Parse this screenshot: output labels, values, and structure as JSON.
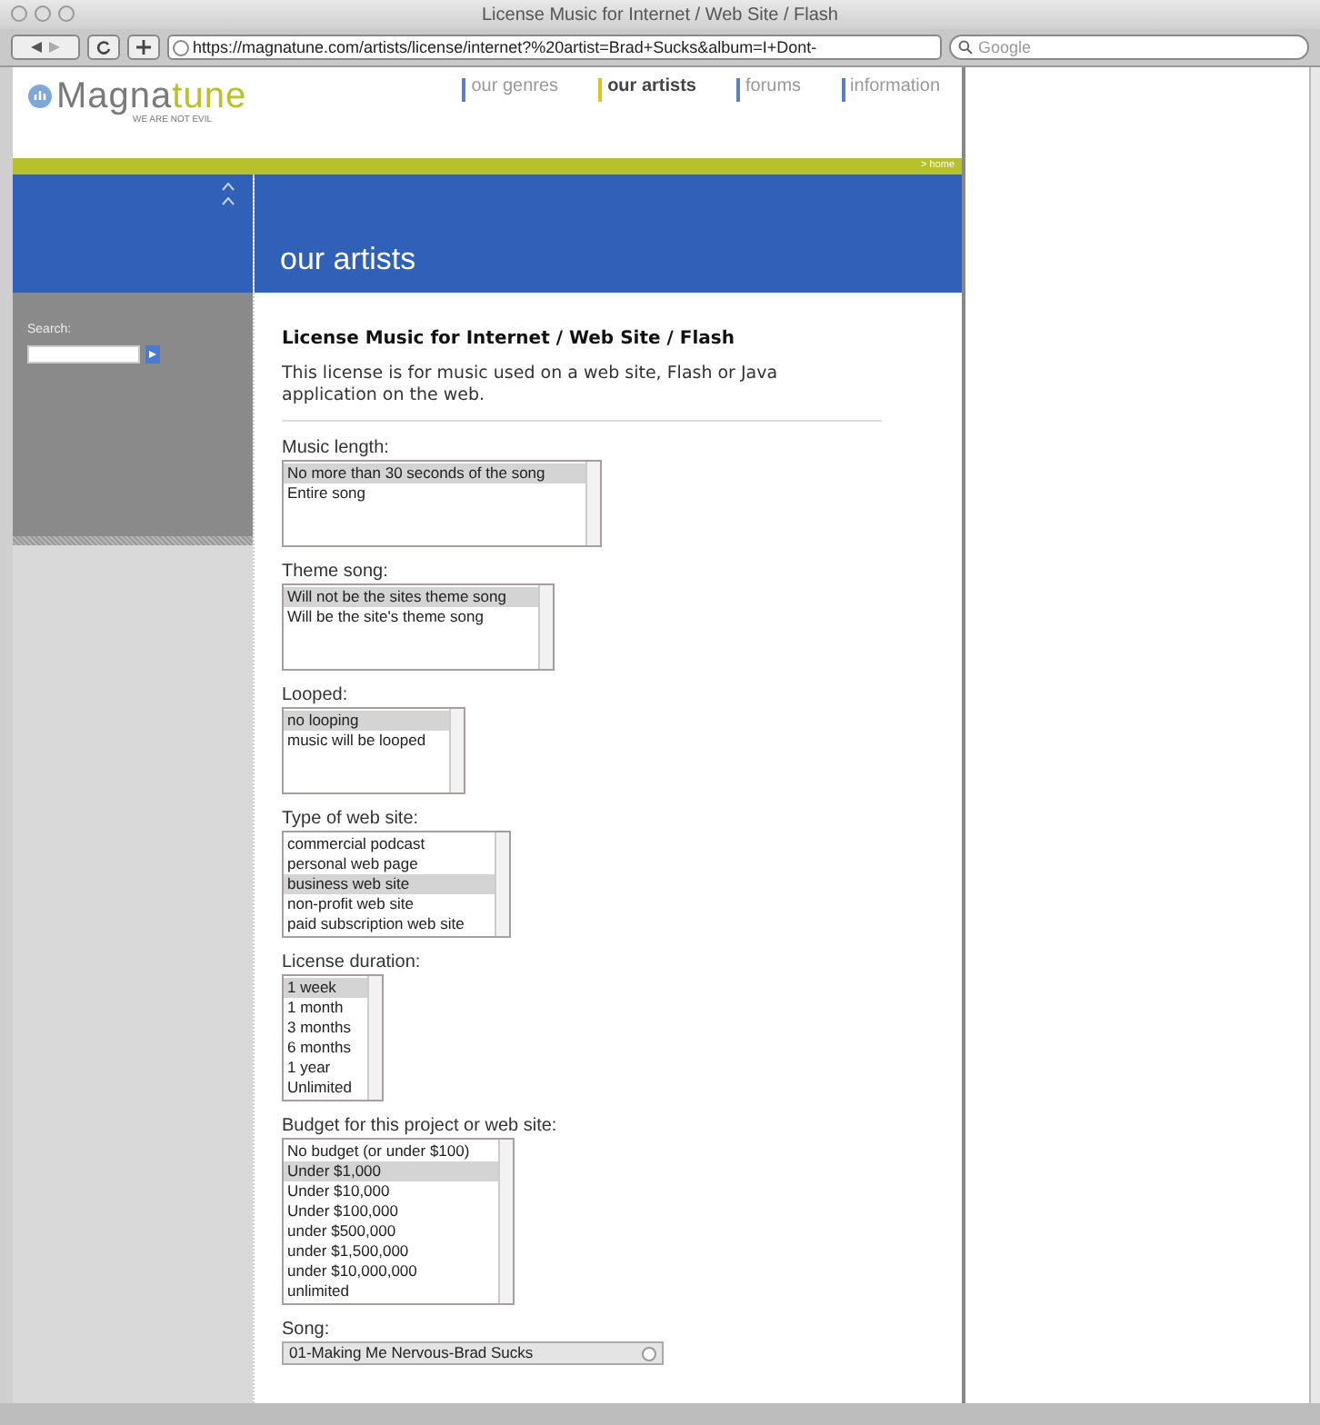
{
  "window": {
    "title": "License Music for Internet / Web Site / Flash"
  },
  "toolbar": {
    "url": "https://magnatune.com/artists/license/internet?%20artist=Brad+Sucks&album=I+Dont-",
    "search": {
      "placeholder": "Google"
    }
  },
  "site": {
    "logo": {
      "part_1": "Magna",
      "part_2": "tune",
      "tagline": "WE ARE NOT EVIL"
    },
    "nav": [
      {
        "label": "our genres",
        "selected": false,
        "color": "#5b7fc4"
      },
      {
        "label": "our artists",
        "selected": true,
        "color": "#e0c21a"
      },
      {
        "label": "forums",
        "selected": false,
        "color": "#5b7fc4"
      },
      {
        "label": "information",
        "selected": false,
        "color": "#5b7fc4"
      }
    ],
    "breadcrumb": "> home",
    "section_title": "our artists",
    "search_label": "Search:"
  },
  "form": {
    "heading": "License Music for Internet / Web Site / Flash",
    "intro": "This license is for music used on a web site, Flash or Java application on the web.",
    "fields": [
      {
        "kind": "listbox",
        "label": "Music length:",
        "options": [
          {
            "label": "No more than 30 seconds of the song",
            "selected": true
          },
          {
            "label": "Entire song",
            "selected": false
          }
        ]
      },
      {
        "kind": "listbox",
        "label": "Theme song:",
        "options": [
          {
            "label": "Will not be the sites theme song",
            "selected": true
          },
          {
            "label": "Will be the site's theme song",
            "selected": false
          }
        ]
      },
      {
        "kind": "listbox",
        "label": "Looped:",
        "options": [
          {
            "label": "no looping",
            "selected": true
          },
          {
            "label": "music will be looped",
            "selected": false
          }
        ]
      },
      {
        "kind": "listbox",
        "label": "Type of web site:",
        "options": [
          {
            "label": "commercial podcast",
            "selected": false
          },
          {
            "label": "personal web page",
            "selected": false
          },
          {
            "label": "business web site",
            "selected": true
          },
          {
            "label": "non-profit web site",
            "selected": false
          },
          {
            "label": "paid subscription web site",
            "selected": false
          }
        ]
      },
      {
        "kind": "listbox",
        "label": "License duration:",
        "options": [
          {
            "label": "1 week",
            "selected": true
          },
          {
            "label": "1 month",
            "selected": false
          },
          {
            "label": "3 months",
            "selected": false
          },
          {
            "label": "6 months",
            "selected": false
          },
          {
            "label": "1 year",
            "selected": false
          },
          {
            "label": "Unlimited",
            "selected": false
          }
        ]
      },
      {
        "kind": "listbox",
        "label": "Budget for this project or web site:",
        "options": [
          {
            "label": "No budget (or under $100)",
            "selected": false
          },
          {
            "label": "Under $1,000",
            "selected": true
          },
          {
            "label": "Under $10,000",
            "selected": false
          },
          {
            "label": "Under $100,000",
            "selected": false
          },
          {
            "label": "under $500,000",
            "selected": false
          },
          {
            "label": "under $1,500,000",
            "selected": false
          },
          {
            "label": "under $10,000,000",
            "selected": false
          },
          {
            "label": "unlimited",
            "selected": false
          }
        ]
      },
      {
        "kind": "dropdown",
        "label": "Song:",
        "value": "01-Making Me Nervous-Brad Sucks"
      }
    ]
  }
}
